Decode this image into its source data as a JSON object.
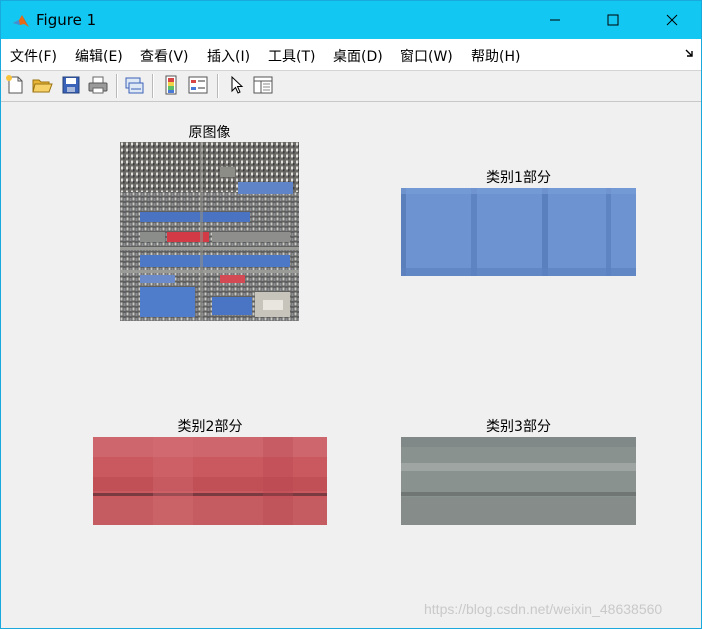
{
  "window": {
    "title": "Figure 1",
    "buttons": {
      "minimize": "minimize",
      "maximize": "maximize",
      "close": "close"
    }
  },
  "menu": [
    {
      "label": "文件(F)"
    },
    {
      "label": "编辑(E)"
    },
    {
      "label": "查看(V)"
    },
    {
      "label": "插入(I)"
    },
    {
      "label": "工具(T)"
    },
    {
      "label": "桌面(D)"
    },
    {
      "label": "窗口(W)"
    },
    {
      "label": "帮助(H)"
    }
  ],
  "toolbar": {
    "icons": [
      "new-figure-icon",
      "open-file-icon",
      "save-icon",
      "print-icon",
      "link-plot-icon",
      "insert-colorbar-icon",
      "insert-legend-icon",
      "select-pointer-icon",
      "property-inspector-icon"
    ]
  },
  "figure": {
    "panels": [
      {
        "title": "原图像",
        "content": "aerial-photo"
      },
      {
        "title": "类别1部分",
        "content": "blue-region",
        "color": "#6a8fcc"
      },
      {
        "title": "类别2部分",
        "content": "red-region",
        "color": "#c8565c"
      },
      {
        "title": "类别3部分",
        "content": "gray-region",
        "color": "#8a9290"
      }
    ],
    "watermark": "https://blog.csdn.net/weixin_48638560"
  },
  "colors": {
    "titlebar": "#12c8f2",
    "background": "#f0f0f0"
  }
}
